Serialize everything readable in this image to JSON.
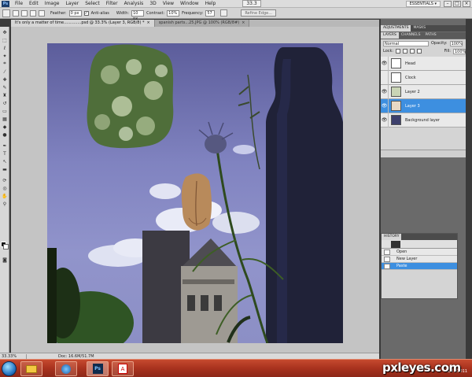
{
  "app": {
    "logo_text": "Ps"
  },
  "menubar": {
    "items": [
      "File",
      "Edit",
      "Image",
      "Layer",
      "Select",
      "Filter",
      "Analysis",
      "3D",
      "View",
      "Window",
      "Help"
    ],
    "zoom": "33.3",
    "workspace": "ESSENTIALS ▾"
  },
  "options_bar": {
    "feather_label": "Feather:",
    "feather_value": "0 px",
    "antialias_label": "Anti-alias",
    "width_label": "Width:",
    "width_value": "10 px",
    "contrast_label": "Contrast:",
    "contrast_value": "10%",
    "frequency_label": "Frequency:",
    "frequency_value": "57",
    "refine_label": "Refine Edge..."
  },
  "doc_tabs": [
    {
      "label": "It's only a matter of time..............psd @ 33.3% (Layer 3, RGB/8) *",
      "active": true
    },
    {
      "label": "spanish parts...25.JPG @ 100% (RGB/8#)",
      "active": false
    }
  ],
  "status_bar": {
    "zoom": "33.33%",
    "doc": "Doc: 16.6M/51.7M"
  },
  "adjustments_tabs": [
    "ADJUSTMENTS",
    "MASKS"
  ],
  "layers_tabs": [
    "LAYERS",
    "CHANNELS",
    "PATHS"
  ],
  "layers_panel": {
    "blend_mode": "Normal",
    "opacity_label": "Opacity:",
    "opacity_value": "100%",
    "lock_label": "Lock:",
    "fill_label": "Fill:",
    "fill_value": "100%",
    "layers": [
      {
        "name": "Head",
        "visible": true,
        "active": false
      },
      {
        "name": "Clock",
        "visible": false,
        "active": false
      },
      {
        "name": "Layer 2",
        "visible": true,
        "active": false
      },
      {
        "name": "Layer 3",
        "visible": true,
        "active": true
      },
      {
        "name": "Background layer",
        "visible": true,
        "active": false
      }
    ]
  },
  "history_panel": {
    "title": "HISTORY",
    "items": [
      {
        "label": "Open",
        "active": false
      },
      {
        "label": "New Layer",
        "active": false
      },
      {
        "label": "Paste",
        "active": true
      }
    ]
  },
  "taskbar": {
    "clock": "1/21/2011"
  },
  "watermark": "pxleyes.com",
  "colors": {
    "active_layer": "#3d8fe0",
    "taskbar": "#a8321e"
  }
}
